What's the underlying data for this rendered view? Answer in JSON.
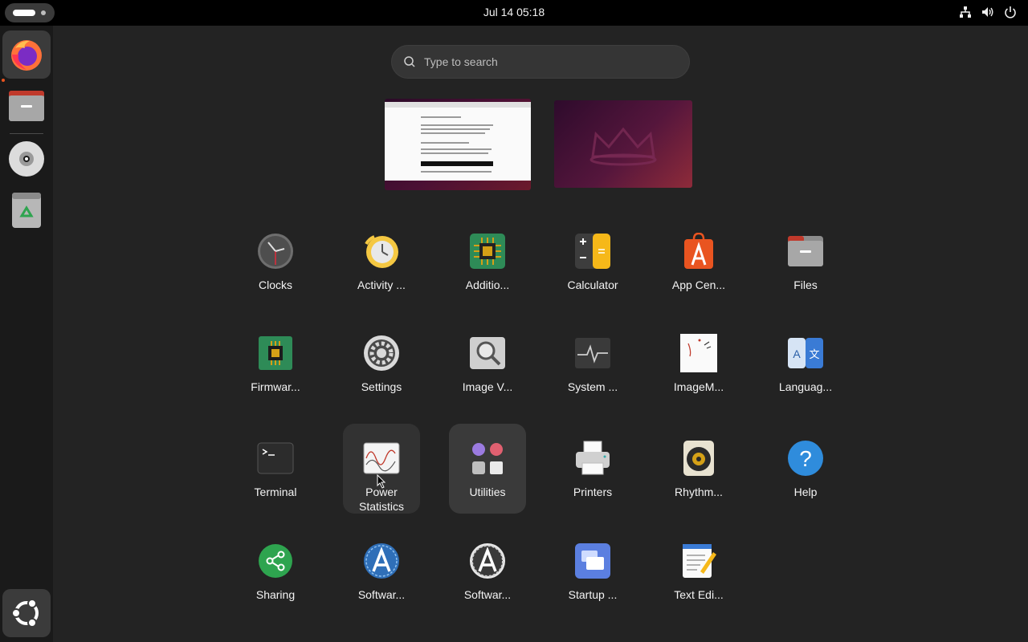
{
  "topbar": {
    "datetime": "Jul 14  05:18",
    "tray_icons": [
      "network-icon",
      "volume-icon",
      "power-icon"
    ]
  },
  "dock": {
    "items": [
      {
        "name": "firefox",
        "icon": "firefox-icon"
      },
      {
        "name": "files",
        "icon": "folder-icon"
      },
      {
        "name": "disc",
        "icon": "disc-icon"
      },
      {
        "name": "trash",
        "icon": "trash-icon"
      },
      {
        "name": "show-apps",
        "icon": "ubuntu-logo-icon"
      }
    ]
  },
  "search": {
    "placeholder": "Type to search"
  },
  "apps": [
    {
      "label": "Clocks",
      "icon": "clock-icon"
    },
    {
      "label": "Activity ...",
      "icon": "activity-log-icon"
    },
    {
      "label": "Additio...",
      "icon": "chip-icon"
    },
    {
      "label": "Calculator",
      "icon": "calculator-icon"
    },
    {
      "label": "App Cen...",
      "icon": "app-center-icon"
    },
    {
      "label": "Files",
      "icon": "folder-icon"
    },
    {
      "label": "Firmwar...",
      "icon": "firmware-icon"
    },
    {
      "label": "Settings",
      "icon": "gear-icon"
    },
    {
      "label": "Image V...",
      "icon": "magnifier-icon"
    },
    {
      "label": "System ...",
      "icon": "system-monitor-icon"
    },
    {
      "label": "ImageM...",
      "icon": "imagemagick-icon"
    },
    {
      "label": "Languag...",
      "icon": "language-icon"
    },
    {
      "label": "Terminal",
      "icon": "terminal-icon"
    },
    {
      "label": "Power Statistics",
      "icon": "power-statistics-icon"
    },
    {
      "label": "Utilities",
      "icon": "utilities-folder-icon"
    },
    {
      "label": "Printers",
      "icon": "printer-icon"
    },
    {
      "label": "Rhythm...",
      "icon": "speaker-icon"
    },
    {
      "label": "Help",
      "icon": "help-icon"
    },
    {
      "label": "Sharing",
      "icon": "share-icon"
    },
    {
      "label": "Softwar...",
      "icon": "software-updater-icon"
    },
    {
      "label": "Softwar...",
      "icon": "software-properties-icon"
    },
    {
      "label": "Startup ...",
      "icon": "startup-apps-icon"
    },
    {
      "label": "Text Edi...",
      "icon": "text-editor-icon"
    }
  ],
  "colors": {
    "accent": "#e95420",
    "topbar": "#000000",
    "background": "#232323",
    "dock": "#1a1a1a"
  }
}
